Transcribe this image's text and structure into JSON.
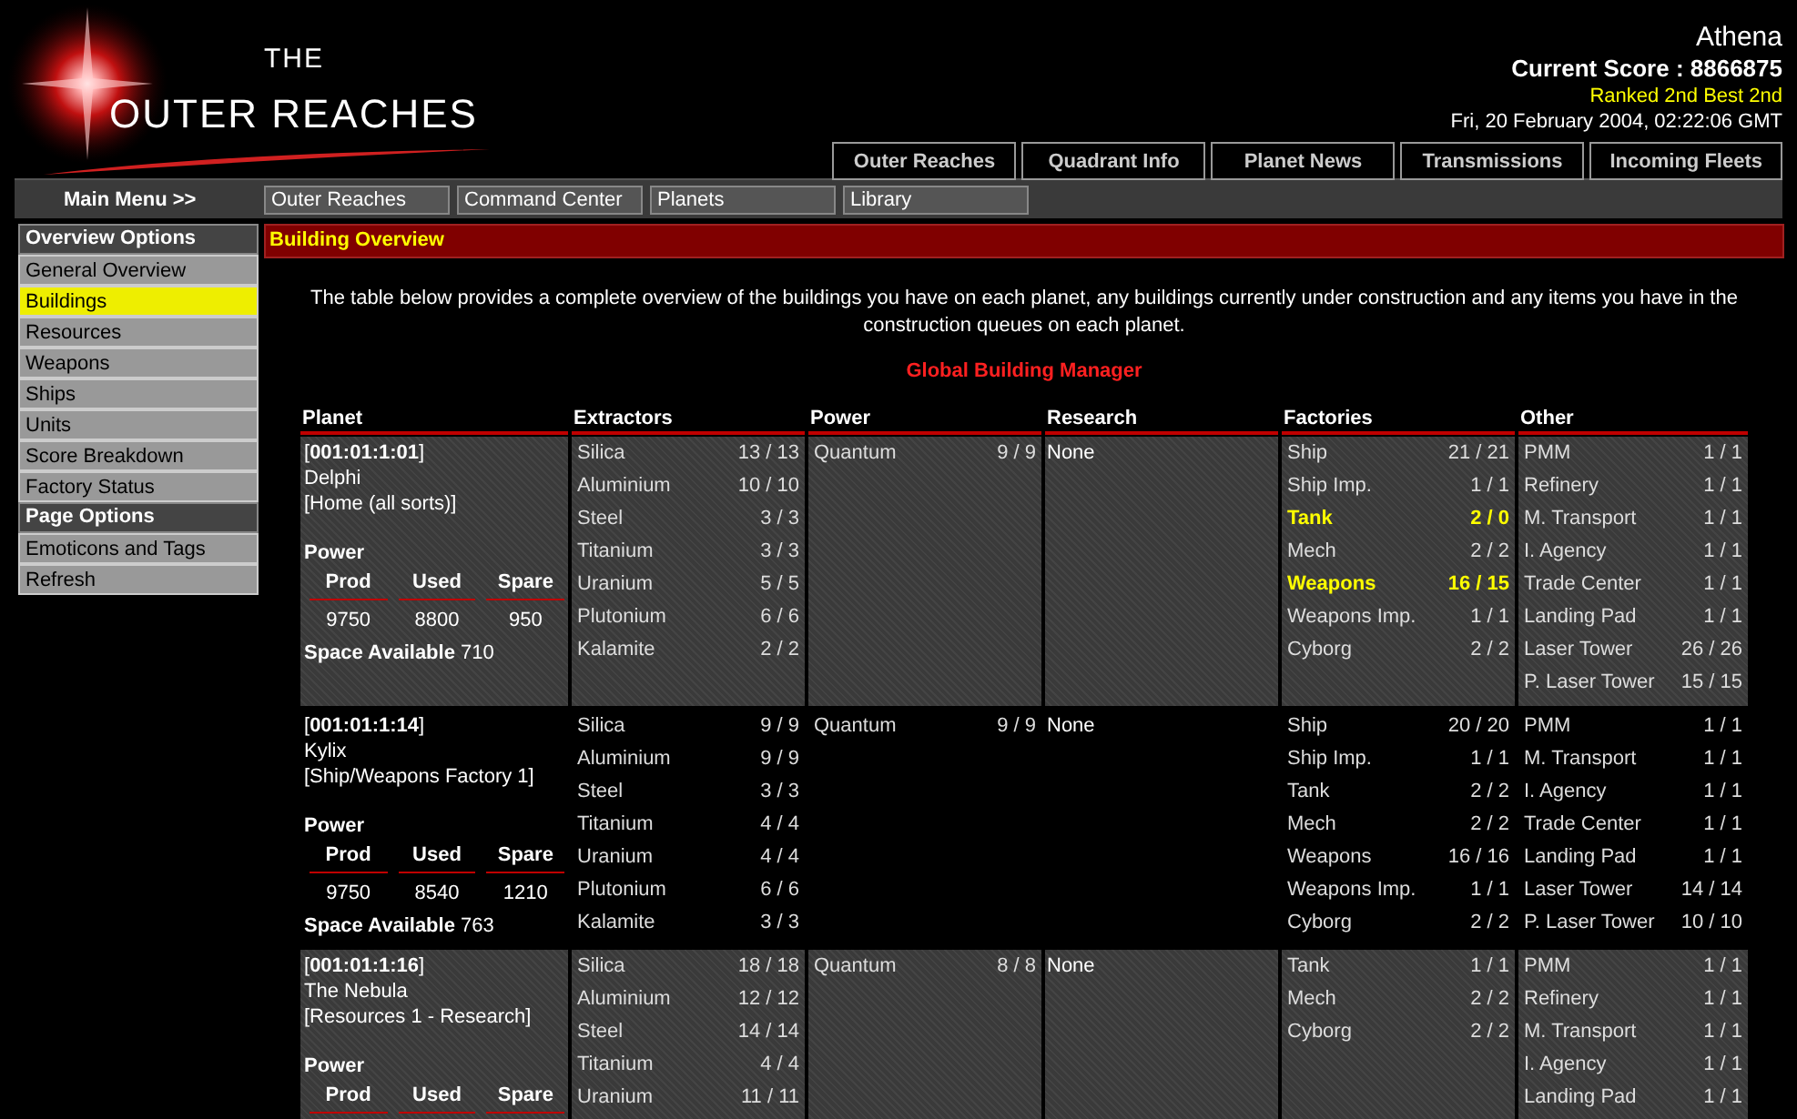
{
  "header": {
    "logo_small": "THE",
    "logo_title": "OUTER REACHES",
    "user": "Athena",
    "score": "Current Score : 8866875",
    "rank": "Ranked 2nd Best 2nd",
    "datetime": "Fri, 20 February 2004, 02:22:06 GMT"
  },
  "top_nav": [
    "Outer Reaches",
    "Quadrant Info",
    "Planet News",
    "Transmissions",
    "Incoming Fleets"
  ],
  "main_menu": {
    "label": "Main Menu >>",
    "items": [
      "Outer Reaches",
      "Command Center",
      "Planets",
      "Library"
    ]
  },
  "sidebar": {
    "sections": [
      {
        "title": "Overview Options",
        "items": [
          {
            "label": "General Overview",
            "selected": false
          },
          {
            "label": "Buildings",
            "selected": true
          },
          {
            "label": "Resources",
            "selected": false
          },
          {
            "label": "Weapons",
            "selected": false
          },
          {
            "label": "Ships",
            "selected": false
          },
          {
            "label": "Units",
            "selected": false
          },
          {
            "label": "Score Breakdown",
            "selected": false
          },
          {
            "label": "Factory Status",
            "selected": false
          }
        ]
      },
      {
        "title": "Page Options",
        "items": [
          {
            "label": "Emoticons and Tags",
            "selected": false
          },
          {
            "label": "Refresh",
            "selected": false
          }
        ]
      }
    ]
  },
  "panel": {
    "title": "Building Overview",
    "intro": "The table below provides a complete overview of the buildings you have on each planet, any buildings currently under construction and any items you have in the construction queues on each planet.",
    "subtitle": "Global Building Manager"
  },
  "table": {
    "columns": [
      "Planet",
      "Extractors",
      "Power",
      "Research",
      "Factories",
      "Other"
    ],
    "rows": [
      {
        "coords": "[**001:01:1:01**]",
        "name": "Delphi",
        "role": "[Home (all sorts)]",
        "power_label": "Power",
        "power_columns": [
          "Prod",
          "Used",
          "Spare"
        ],
        "power_values": [
          "9750",
          "8800",
          "950"
        ],
        "space_label": "Space Available",
        "space_value": "710",
        "extractors": [
          {
            "name": "Silica",
            "count": "13 / 13"
          },
          {
            "name": "Aluminium",
            "count": "10 / 10"
          },
          {
            "name": "Steel",
            "count": "3 / 3"
          },
          {
            "name": "Titanium",
            "count": "3 / 3"
          },
          {
            "name": "Uranium",
            "count": "5 / 5"
          },
          {
            "name": "Plutonium",
            "count": "6 / 6"
          },
          {
            "name": "Kalamite",
            "count": "2 / 2"
          }
        ],
        "power": [
          {
            "name": "Quantum",
            "count": "9 / 9"
          }
        ],
        "research": "None",
        "factories": [
          {
            "name": "Ship",
            "count": "21 / 21",
            "alert": false
          },
          {
            "name": "Ship Imp.",
            "count": "1 / 1",
            "alert": false
          },
          {
            "name": "Tank",
            "count": "2 / 0",
            "alert": true
          },
          {
            "name": "Mech",
            "count": "2 / 2",
            "alert": false
          },
          {
            "name": "Weapons",
            "count": "16 / 15",
            "alert": true
          },
          {
            "name": "Weapons Imp.",
            "count": "1 / 1",
            "alert": false
          },
          {
            "name": "Cyborg",
            "count": "2 / 2",
            "alert": false
          }
        ],
        "other": [
          {
            "name": "PMM",
            "count": "1 / 1"
          },
          {
            "name": "Refinery",
            "count": "1 / 1"
          },
          {
            "name": "M. Transport",
            "count": "1 / 1"
          },
          {
            "name": "I. Agency",
            "count": "1 / 1"
          },
          {
            "name": "Trade Center",
            "count": "1 / 1"
          },
          {
            "name": "Landing Pad",
            "count": "1 / 1"
          },
          {
            "name": "Laser Tower",
            "count": "26 / 26"
          },
          {
            "name": "P. Laser Tower",
            "count": "15 / 15"
          }
        ]
      },
      {
        "coords": "[**001:01:1:14**]",
        "name": "Kylix",
        "role": "[Ship/Weapons Factory 1]",
        "power_label": "Power",
        "power_columns": [
          "Prod",
          "Used",
          "Spare"
        ],
        "power_values": [
          "9750",
          "8540",
          "1210"
        ],
        "space_label": "Space Available",
        "space_value": "763",
        "extractors": [
          {
            "name": "Silica",
            "count": "9 / 9"
          },
          {
            "name": "Aluminium",
            "count": "9 / 9"
          },
          {
            "name": "Steel",
            "count": "3 / 3"
          },
          {
            "name": "Titanium",
            "count": "4 / 4"
          },
          {
            "name": "Uranium",
            "count": "4 / 4"
          },
          {
            "name": "Plutonium",
            "count": "6 / 6"
          },
          {
            "name": "Kalamite",
            "count": "3 / 3"
          }
        ],
        "power": [
          {
            "name": "Quantum",
            "count": "9 / 9"
          }
        ],
        "research": "None",
        "factories": [
          {
            "name": "Ship",
            "count": "20 / 20",
            "alert": false
          },
          {
            "name": "Ship Imp.",
            "count": "1 / 1",
            "alert": false
          },
          {
            "name": "Tank",
            "count": "2 / 2",
            "alert": false
          },
          {
            "name": "Mech",
            "count": "2 / 2",
            "alert": false
          },
          {
            "name": "Weapons",
            "count": "16 / 16",
            "alert": false
          },
          {
            "name": "Weapons Imp.",
            "count": "1 / 1",
            "alert": false
          },
          {
            "name": "Cyborg",
            "count": "2 / 2",
            "alert": false
          }
        ],
        "other": [
          {
            "name": "PMM",
            "count": "1 / 1"
          },
          {
            "name": "M. Transport",
            "count": "1 / 1"
          },
          {
            "name": "I. Agency",
            "count": "1 / 1"
          },
          {
            "name": "Trade Center",
            "count": "1 / 1"
          },
          {
            "name": "Landing Pad",
            "count": "1 / 1"
          },
          {
            "name": "Laser Tower",
            "count": "14 / 14"
          },
          {
            "name": "P. Laser Tower",
            "count": "10 / 10"
          }
        ]
      },
      {
        "coords": "[**001:01:1:16**]",
        "name": "The Nebula",
        "role": "[Resources 1 - Research]",
        "power_label": "Power",
        "power_columns": [
          "Prod",
          "Used",
          "Spare"
        ],
        "extractors": [
          {
            "name": "Silica",
            "count": "18 / 18"
          },
          {
            "name": "Aluminium",
            "count": "12 / 12"
          },
          {
            "name": "Steel",
            "count": "14 / 14"
          },
          {
            "name": "Titanium",
            "count": "4 / 4"
          },
          {
            "name": "Uranium",
            "count": "11 / 11"
          }
        ],
        "power": [
          {
            "name": "Quantum",
            "count": "8 / 8"
          }
        ],
        "research": "None",
        "factories": [
          {
            "name": "Tank",
            "count": "1 / 1",
            "alert": false
          },
          {
            "name": "Mech",
            "count": "2 / 2",
            "alert": false
          },
          {
            "name": "Cyborg",
            "count": "2 / 2",
            "alert": false
          }
        ],
        "other": [
          {
            "name": "PMM",
            "count": "1 / 1"
          },
          {
            "name": "Refinery",
            "count": "1 / 1"
          },
          {
            "name": "M. Transport",
            "count": "1 / 1"
          },
          {
            "name": "I. Agency",
            "count": "1 / 1"
          },
          {
            "name": "Landing Pad",
            "count": "1 / 1"
          }
        ]
      }
    ]
  }
}
